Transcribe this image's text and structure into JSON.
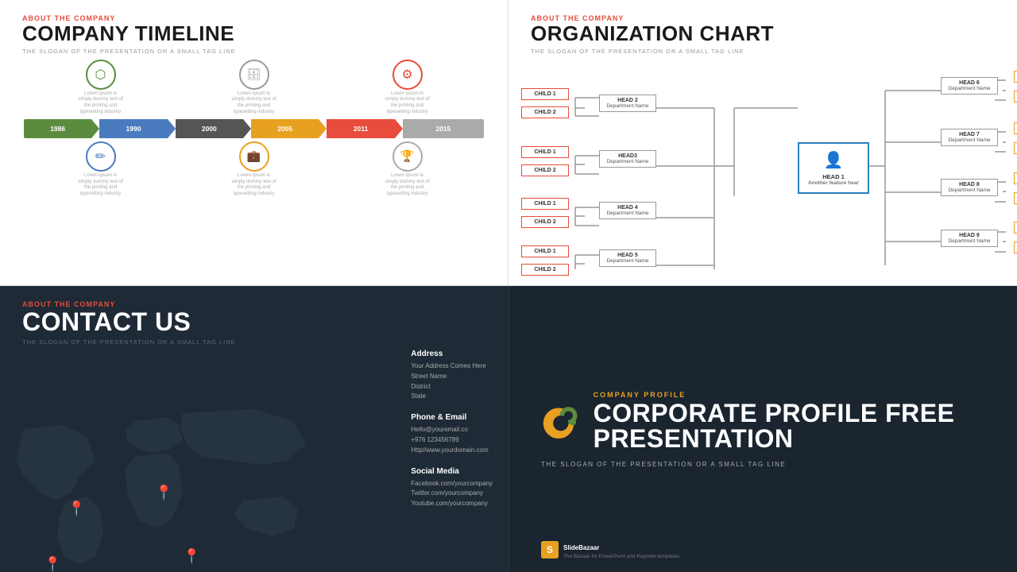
{
  "q1": {
    "about": "ABOUT THE COMPANY",
    "title": "COMPANY TIMELINE",
    "tagline": "THE SLOGAN OF THE PRESENTATION OR A SMALL TAG LINE",
    "icons_top": [
      {
        "symbol": "⬡",
        "class": "ic1",
        "text": "Lorem Ipsum is simply dummy text of the printing and typesetting industry"
      },
      {
        "symbol": "🗄",
        "class": "ic2",
        "text": "Lorem Ipsum is simply dummy text of the printing and typesetting industry"
      },
      {
        "symbol": "⚙",
        "class": "ic3",
        "text": "Lorem Ipsum is simply dummy text of the printing and typesetting industry"
      }
    ],
    "years": [
      "1986",
      "1990",
      "2000",
      "2005",
      "2011",
      "2015"
    ],
    "icons_bottom": [
      {
        "symbol": "✏",
        "class": "ic4",
        "text": "Lorem Ipsum is simply dummy text of the printing and typesetting industry"
      },
      {
        "symbol": "💼",
        "class": "ic5",
        "text": "Lorem Ipsum is simply dummy text of the printing and typesetting industry"
      },
      {
        "symbol": "🏆",
        "class": "ic6",
        "text": "Lorem Ipsum is simply dummy text of the printing and typesetting industry"
      }
    ]
  },
  "q2": {
    "about": "ABOUT THE COMPANY",
    "title": "ORGANIZATION CHART",
    "tagline": "THE SLOGAN OF THE PRESENTATION OR A SMALL TAG LINE",
    "head1": {
      "name": "HEAD 1",
      "dept": "Another feature hear"
    },
    "head2": {
      "name": "HEAD 2",
      "dept": "Department Name"
    },
    "head3": {
      "name": "HEAD3",
      "dept": "Department Name"
    },
    "head4": {
      "name": "HEAD 4",
      "dept": "Department Name"
    },
    "head5": {
      "name": "HEAD 5",
      "dept": "Department Name"
    },
    "head6": {
      "name": "HEAD 6",
      "dept": "Department Name"
    },
    "head7": {
      "name": "HEAD 7",
      "dept": "Department Name"
    },
    "head8": {
      "name": "HEAD 8",
      "dept": "Department Name"
    },
    "head9": {
      "name": "HEAD 9",
      "dept": "Department Name"
    },
    "child1": "CHILD 1",
    "child2": "CHILD 2"
  },
  "q3": {
    "about": "ABOUT THE COMPANY",
    "title": "CONTACT US",
    "tagline": "THE SLOGAN OF THE PRESENTATION OR A SMALL TAG LINE",
    "address_title": "Address",
    "address_lines": [
      "Your Address Comes Here",
      "Street Name",
      "District",
      "State"
    ],
    "phone_title": "Phone & Email",
    "phone_lines": [
      "Hello@youremail.co",
      "+976 123456789",
      "Http//www.yourdomain.com"
    ],
    "social_title": "Social Media",
    "social_lines": [
      "Facebook.com/yourcompany",
      "Twitter.com/yourcompany",
      "Youtube.com/yourcompany"
    ]
  },
  "q4": {
    "company_profile_label": "COMPANY PROFILE",
    "title": "CORPORATE PROFILE FREE PRESENTATION",
    "tagline": "THE SLOGAN OF THE PRESENTATION OR A SMALL TAG LINE",
    "sb_brand": "S",
    "sb_name": "SlideBazaar",
    "sb_sub": "The Bazaar for PowerPoint and Keynote templates"
  }
}
